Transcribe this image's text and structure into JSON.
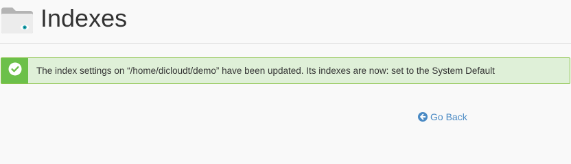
{
  "header": {
    "title": "Indexes",
    "icon": "folder-eye-icon"
  },
  "alert": {
    "type": "success",
    "icon": "check-circle-icon",
    "message": "The index settings on “/home/dicloudt/demo” have been updated. Its indexes are now: set to the System Default",
    "colors": {
      "background": "#dff0d8",
      "border": "#8bc34a",
      "icon_background": "#6cc04a"
    }
  },
  "actions": {
    "go_back_label": "Go Back",
    "go_back_icon": "arrow-circle-left-icon",
    "link_color": "#4a8ac4"
  }
}
